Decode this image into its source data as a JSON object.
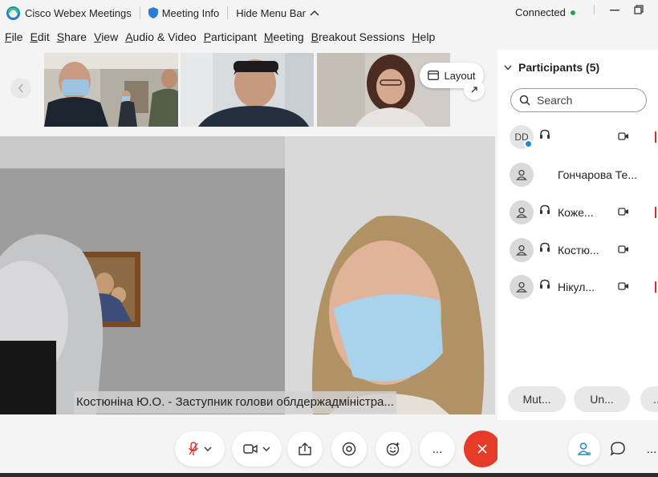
{
  "titlebar": {
    "app_name": "Cisco Webex Meetings",
    "meeting_info": "Meeting Info",
    "hide_menu": "Hide Menu Bar",
    "status": "Connected"
  },
  "menu": {
    "items": [
      "File",
      "Edit",
      "Share",
      "View",
      "Audio & Video",
      "Participant",
      "Meeting",
      "Breakout Sessions",
      "Help"
    ]
  },
  "strip": {
    "layout_label": "Layout"
  },
  "main_video": {
    "caption": "Костюніна Ю.О. - Заступник голови облдержадміністра..."
  },
  "participants": {
    "header": "Participants (5)",
    "search_placeholder": "Search",
    "list": [
      {
        "initials": "DD",
        "name": ""
      },
      {
        "initials": "",
        "name": "Гончарова Те..."
      },
      {
        "initials": "",
        "name": "Коже..."
      },
      {
        "initials": "",
        "name": "Костю..."
      },
      {
        "initials": "",
        "name": "Нікул..."
      }
    ],
    "mute_all": "Mut...",
    "unmute_all": "Un...",
    "more": "..."
  },
  "controls": {
    "more": "..."
  },
  "colors": {
    "accent": "#1f8ac9",
    "end_call": "#e63b29",
    "connected": "#26a44a",
    "mute_red": "#d6302a"
  }
}
